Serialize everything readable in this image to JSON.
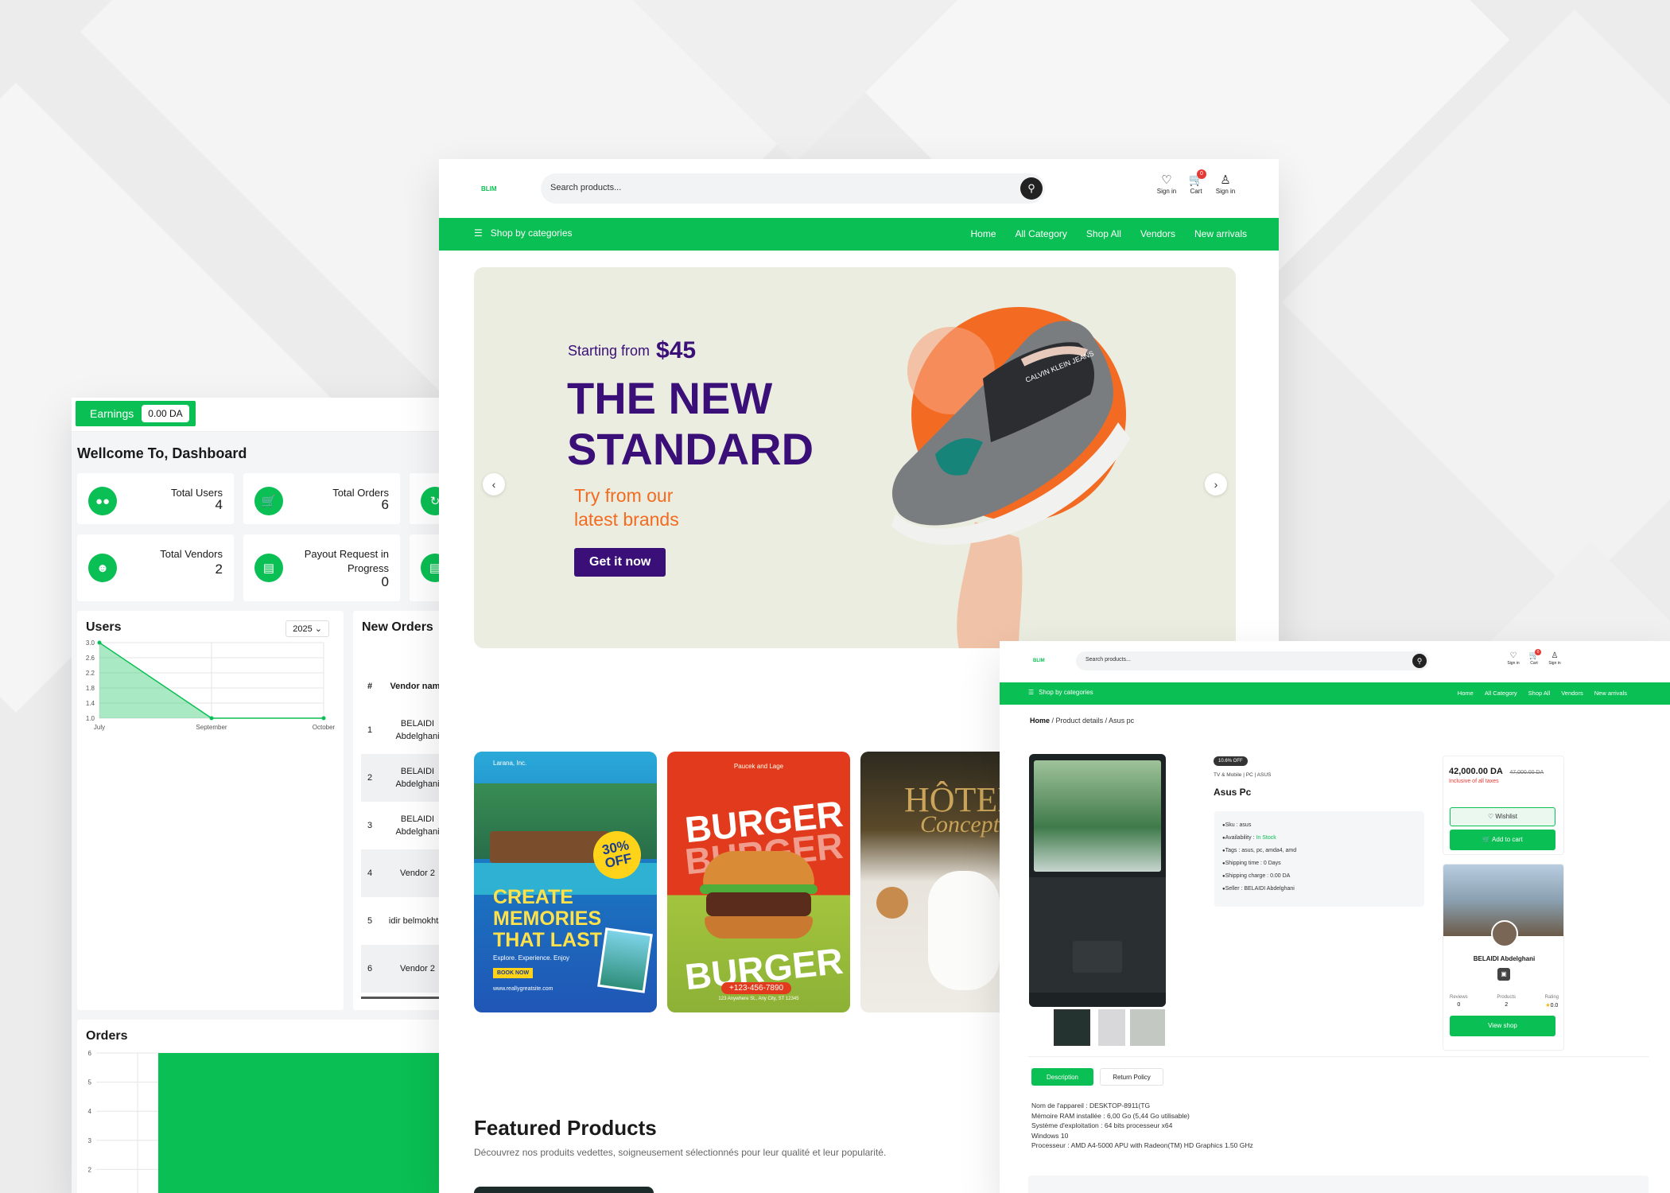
{
  "dashboard": {
    "earnings_label": "Earnings",
    "earnings_value": "0.00 DA",
    "title": "Wellcome To, Dashboard",
    "stats": [
      {
        "label": "Total Users",
        "value": "4"
      },
      {
        "label": "Total Orders",
        "value": "6"
      },
      {
        "label": "Total Vendors",
        "value": "2"
      },
      {
        "label": "Payout Request in Progress",
        "value": "0"
      }
    ],
    "users_chart_title": "Users",
    "year_select": "2025",
    "new_orders_title": "New Orders",
    "orders_table": {
      "headers": [
        "#",
        "Vendor name"
      ],
      "rows": [
        {
          "n": "1",
          "vendor": "BELAIDI Abdelghani"
        },
        {
          "n": "2",
          "vendor": "BELAIDI Abdelghani"
        },
        {
          "n": "3",
          "vendor": "BELAIDI Abdelghani"
        },
        {
          "n": "4",
          "vendor": "Vendor 2"
        },
        {
          "n": "5",
          "vendor": "idir belmokhtar"
        },
        {
          "n": "6",
          "vendor": "Vendor 2"
        }
      ]
    },
    "orders_chart_title": "Orders",
    "orders_y_ticks": [
      "6",
      "5",
      "4",
      "3",
      "2"
    ]
  },
  "chart_data": [
    {
      "type": "area",
      "title": "Users",
      "categories": [
        "July",
        "September",
        "October"
      ],
      "values": [
        3.0,
        1.0,
        1.0
      ],
      "ylim": [
        1.0,
        3.0
      ],
      "yticks": [
        "3.0",
        "2.6",
        "2.2",
        "1.8",
        "1.4",
        "1.0"
      ]
    },
    {
      "type": "bar",
      "title": "Orders",
      "values": [
        6
      ],
      "ylim": [
        1,
        6
      ]
    }
  ],
  "store": {
    "logo": "BLIM",
    "search_placeholder": "Search products...",
    "header_icons": [
      {
        "icon": "heart-icon",
        "label": "Sign in"
      },
      {
        "icon": "cart-icon",
        "label": "Cart",
        "badge": "0"
      },
      {
        "icon": "user-icon",
        "label": "Sign in"
      }
    ],
    "nav_categories": "Shop by categories",
    "nav_links": [
      "Home",
      "All Category",
      "Shop All",
      "Vendors",
      "New arrivals"
    ],
    "hero": {
      "starting_from": "Starting from",
      "price": "$45",
      "title_line1": "THE NEW",
      "title_line2": "STANDARD",
      "sub_line1": "Try from our",
      "sub_line2": "latest brands",
      "cta": "Get it now",
      "shoe_brand": "CALVIN KLEIN JEANS"
    },
    "promo1": {
      "small": "Larana, Inc.",
      "badge_pct": "30%",
      "badge_off": "OFF",
      "headline": [
        "CREATE",
        "MEMORIES",
        "THAT LAST"
      ],
      "tagline": "Explore. Experience. Enjoy",
      "btn": "BOOK NOW",
      "site": "www.reallygreatsite.com"
    },
    "promo2": {
      "small": "Paucek and Lage",
      "word": "BURGER",
      "phone": "+123-456-7890",
      "address": "123 Anywhere St., Any City, ST 12345"
    },
    "promo3": {
      "title": "HÔTEL",
      "script": "Concept"
    },
    "featured_title": "Featured Products",
    "featured_sub": "Découvrez nos produits vedettes, soigneusement sélectionnés pour leur qualité et leur popularité."
  },
  "product_page": {
    "logo": "BLIM",
    "search_placeholder": "Search products...",
    "header_icons": [
      {
        "icon": "heart-icon",
        "label": "Sign in"
      },
      {
        "icon": "cart-icon",
        "label": "Cart",
        "badge": "0"
      },
      {
        "icon": "user-icon",
        "label": "Sign in"
      }
    ],
    "nav_categories": "Shop by categories",
    "nav_links": [
      "Home",
      "All Category",
      "Shop All",
      "Vendors",
      "New arrivals"
    ],
    "breadcrumb": [
      "Home",
      "Product details",
      "Asus pc"
    ],
    "discount": "10.6% OFF",
    "category_path": "TV & Mobile | PC | ASUS",
    "product_name": "Asus Pc",
    "specs": [
      {
        "label": "Sku",
        "value": "asus"
      },
      {
        "label": "Availability",
        "value": "In Stock"
      },
      {
        "label": "Tags",
        "value": "asus, pc, amda4, amd"
      },
      {
        "label": "Shipping time",
        "value": "0 Days"
      },
      {
        "label": "Shipping charge",
        "value": "0.00 DA"
      },
      {
        "label": "Seller",
        "value": "BELAIDI Abdelghani"
      }
    ],
    "price": "42,000.00 DA",
    "old_price": "47,000.00 DA",
    "tax_note": "Inclusive of all taxes",
    "wishlist_btn": "Wishlist",
    "add_to_cart_btn": "Add to cart",
    "seller": {
      "name": "BELAIDI Abdelghani",
      "stats": [
        {
          "label": "Reviews",
          "value": "0"
        },
        {
          "label": "Products",
          "value": "2"
        },
        {
          "label": "Rating",
          "value": "0.0"
        }
      ],
      "view_shop_btn": "View shop"
    },
    "tabs": [
      "Description",
      "Return Policy"
    ],
    "description": [
      "Nom de l'appareil : DESKTOP-8911(TG",
      "Mémoire RAM installée : 6,00 Go (5,44 Go utilisable)",
      "Système d'exploitation : 64 bits processeur x64",
      "Windows 10",
      "Processeur : AMD A4-5000 APU with Radeon(TM) HD Graphics 1.50 GHz"
    ],
    "colors": {
      "accent": "#0abf53",
      "danger": "#e53935",
      "hero_purple": "#3a1078",
      "hero_orange": "#f26b21"
    }
  }
}
